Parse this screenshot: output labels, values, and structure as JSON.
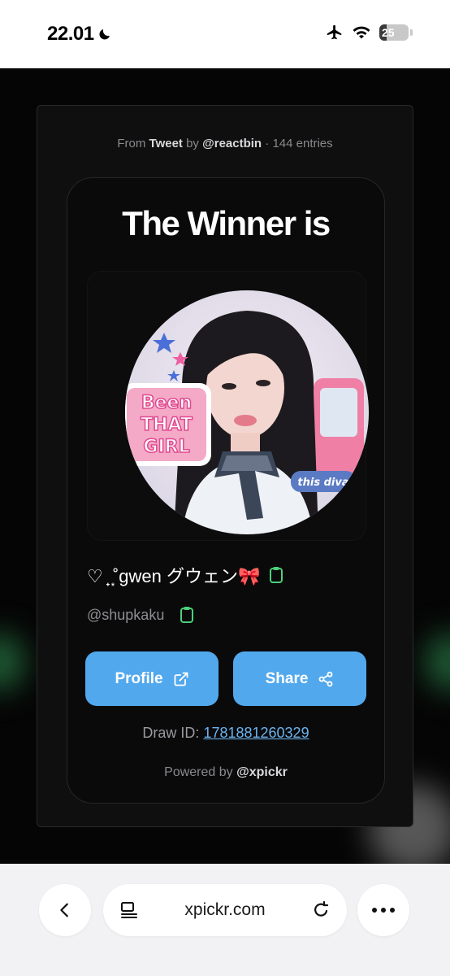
{
  "status_bar": {
    "time": "22.01",
    "battery": "25",
    "battery_level": 0.25,
    "icons": [
      "moon-icon",
      "airplane-icon",
      "wifi-icon",
      "battery-icon"
    ]
  },
  "modal": {
    "source_prefix": "From",
    "source_type": "Tweet",
    "source_by": "by",
    "source_handle": "@reactbin",
    "source_separator": "·",
    "entries": "144 entries"
  },
  "winner": {
    "title": "The Winner is",
    "name": "♡ ̟ ͙˚gwen グウェン🎀",
    "handle": "@shupkaku",
    "avatar_sticker_text": [
      "Been",
      "THAT",
      "GIRL"
    ],
    "avatar_caption": "this diva"
  },
  "actions": {
    "profile_label": "Profile",
    "share_label": "Share"
  },
  "footer": {
    "draw_id_label": "Draw ID:",
    "draw_id": "1781881260329",
    "powered_by": "Powered by",
    "powered_handle": "@xpickr"
  },
  "browser": {
    "url": "xpickr.com"
  },
  "colors": {
    "accent": "#52a8ec",
    "copy_icon": "#4cd07a",
    "card_bg": "#0a0a0b",
    "link": "#6ab4f0"
  }
}
